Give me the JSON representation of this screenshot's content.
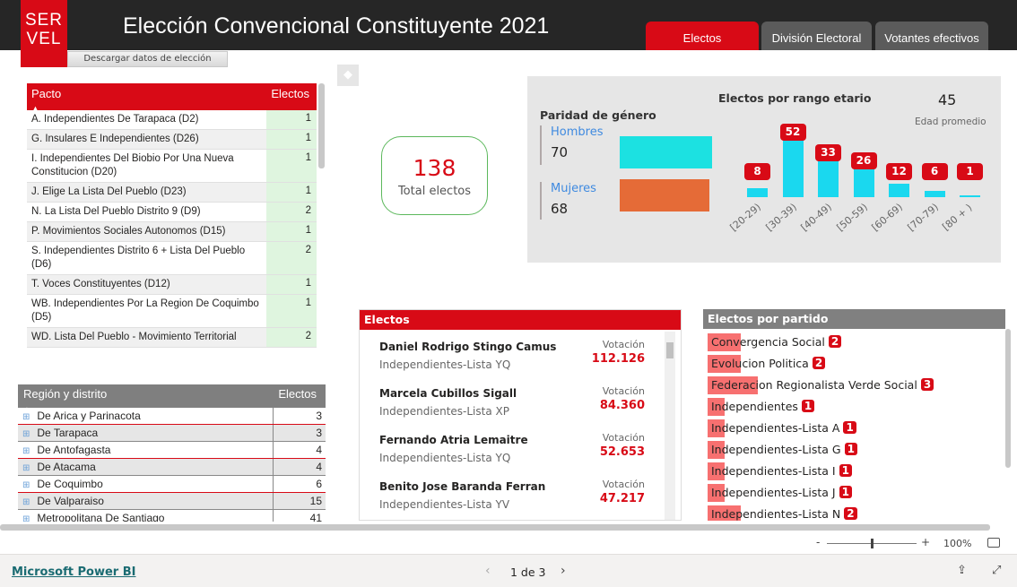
{
  "header": {
    "logo_text": "SER VEL",
    "title": "Elección Convencional Constituyente 2021",
    "tabs": [
      {
        "label": "Electos",
        "active": true
      },
      {
        "label": "División Electoral",
        "active": false
      },
      {
        "label": "Votantes efectivos",
        "active": false
      }
    ],
    "download_label": "Descargar datos de elección"
  },
  "pacto_table": {
    "col1": "Pacto",
    "col2": "Electos",
    "rows": [
      {
        "name": "A. Independientes De Tarapaca (D2)",
        "value": "1"
      },
      {
        "name": "G. Insulares E Independientes (D26)",
        "value": "1"
      },
      {
        "name": "I. Independientes Del Biobio Por Una Nueva Constitucion (D20)",
        "value": "1"
      },
      {
        "name": "J. Elige La Lista Del Pueblo (D23)",
        "value": "1"
      },
      {
        "name": "N. La Lista Del Pueblo Distrito 9 (D9)",
        "value": "2"
      },
      {
        "name": "P. Movimientos Sociales Autonomos (D15)",
        "value": "1"
      },
      {
        "name": "S. Independientes Distrito 6 + Lista Del Pueblo (D6)",
        "value": "2"
      },
      {
        "name": "T. Voces Constituyentes (D12)",
        "value": "1"
      },
      {
        "name": "WB. Independientes Por La Region De Coquimbo (D5)",
        "value": "1"
      },
      {
        "name": "WD. Lista Del Pueblo - Movimiento Territorial",
        "value": "2"
      }
    ]
  },
  "region_table": {
    "col1": "Región y distrito",
    "col2": "Electos",
    "rows": [
      {
        "name": "De Arica y Parinacota",
        "value": "3"
      },
      {
        "name": "De Tarapaca",
        "value": "3"
      },
      {
        "name": "De Antofagasta",
        "value": "4"
      },
      {
        "name": "De Atacama",
        "value": "4"
      },
      {
        "name": "De Coquimbo",
        "value": "6"
      },
      {
        "name": "De Valparaiso",
        "value": "15"
      },
      {
        "name": "Metropolitana De Santiago",
        "value": "41"
      }
    ]
  },
  "total": {
    "value": "138",
    "label": "Total electos"
  },
  "gender": {
    "title": "Paridad de género",
    "items": [
      {
        "label": "Hombres",
        "value": 70,
        "color": "#1ce1e1"
      },
      {
        "label": "Mujeres",
        "value": 68,
        "color": "#e56b37"
      }
    ]
  },
  "age": {
    "title": "Electos por rango etario",
    "avg_value": "45",
    "avg_label": "Edad promedio",
    "categories": [
      "[20-29)",
      "[30-39)",
      "[40-49)",
      "[50-59)",
      "[60-69)",
      "[70-79)",
      "[80 + )"
    ],
    "values": [
      8,
      52,
      33,
      26,
      12,
      6,
      1
    ],
    "bar_color": "#1ad8ef"
  },
  "electos": {
    "title": "Electos",
    "vot_label": "Votación",
    "rows": [
      {
        "name": "Daniel Rodrigo Stingo Camus",
        "list": "Independientes-Lista YQ",
        "votes": "112.126"
      },
      {
        "name": "Marcela Cubillos Sigall",
        "list": "Independientes-Lista XP",
        "votes": "84.360"
      },
      {
        "name": "Fernando Atria Lemaitre",
        "list": "Independientes-Lista YQ",
        "votes": "52.653"
      },
      {
        "name": "Benito Jose Baranda Ferran",
        "list": "Independientes-Lista YV",
        "votes": "47.217"
      }
    ]
  },
  "partidos": {
    "title": "Electos por partido",
    "rows": [
      {
        "name": "Convergencia Social",
        "value": 2
      },
      {
        "name": "Evolucion Politica",
        "value": 2
      },
      {
        "name": "Federacion Regionalista Verde Social",
        "value": 3
      },
      {
        "name": "Independientes",
        "value": 1
      },
      {
        "name": "Independientes-Lista A",
        "value": 1
      },
      {
        "name": "Independientes-Lista G",
        "value": 1
      },
      {
        "name": "Independientes-Lista I",
        "value": 1
      },
      {
        "name": "Independientes-Lista J",
        "value": 1
      },
      {
        "name": "Independientes-Lista N",
        "value": 2
      }
    ]
  },
  "zoom": {
    "minus": "-",
    "plus": "+",
    "level": "100%",
    "fraction": 0.5
  },
  "footer": {
    "brand": "Microsoft Power BI",
    "page": "1 de 3"
  }
}
